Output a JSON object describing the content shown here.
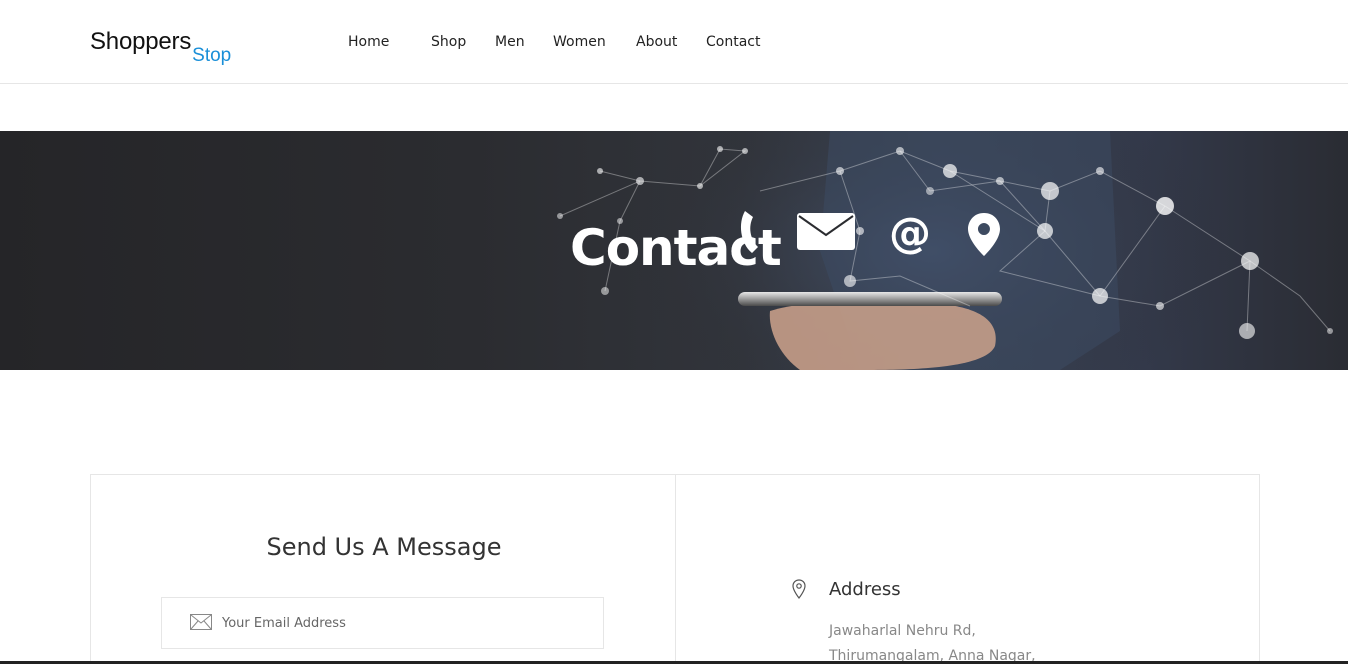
{
  "logo": {
    "main": "Shoppers",
    "sub": "Stop"
  },
  "nav": [
    {
      "label": "Home"
    },
    {
      "label": "Shop"
    },
    {
      "label": "Men"
    },
    {
      "label": "Women"
    },
    {
      "label": "About"
    },
    {
      "label": "Contact"
    }
  ],
  "banner": {
    "title": "Contact"
  },
  "form": {
    "title": "Send Us A Message",
    "email_placeholder": "Your Email Address"
  },
  "address": {
    "title": "Address",
    "lines": [
      "Jawaharlal Nehru Rd,",
      "Thirumangalam, Anna Nagar,"
    ]
  },
  "colors": {
    "accent": "#1a8fd8",
    "banner_dark": "#2b2c30"
  }
}
